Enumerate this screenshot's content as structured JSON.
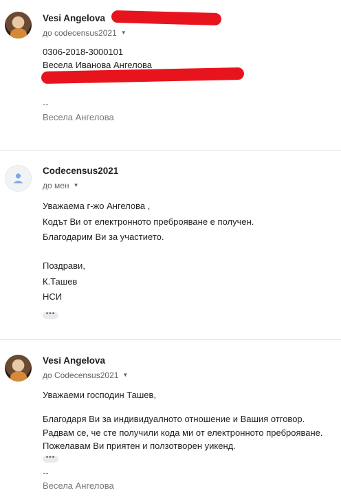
{
  "messages": [
    {
      "sender": "Vesi Angelova",
      "recipient": "до codecensus2021",
      "body": [
        "0306-2018-3000101",
        "Весела Иванова Ангелова"
      ],
      "signature_dash": "--",
      "signature": "Весела Ангелова"
    },
    {
      "sender": "Codecensus2021",
      "recipient": "до мен",
      "body": [
        "Уважаема г-жо Ангелова ,",
        "Кодът Ви от електронното преброяване е получен.",
        "Благодарим Ви за участието.",
        "Поздрави,",
        "К.Ташев",
        "НСИ"
      ],
      "ellipsis": "•••"
    },
    {
      "sender": "Vesi Angelova",
      "recipient": "до Codecensus2021",
      "body": [
        "Уважаеми господин Ташев,",
        "Благодаря Ви за индивидуалното отношение и Вашия отговор.",
        "Радвам се, че сте получили кода ми от електронното преброяване.",
        "Пожелавам Ви приятен и ползотворен уикенд."
      ],
      "ellipsis": "•••",
      "signature_dash": "--",
      "signature": "Весела Ангелова"
    }
  ],
  "icons": {
    "recipient_toggle": "chevron-down-icon",
    "avatar_placeholder": "person-icon"
  },
  "colors": {
    "redaction": "#e8141d",
    "avatar_placeholder_icon": "#7fa7e8"
  }
}
